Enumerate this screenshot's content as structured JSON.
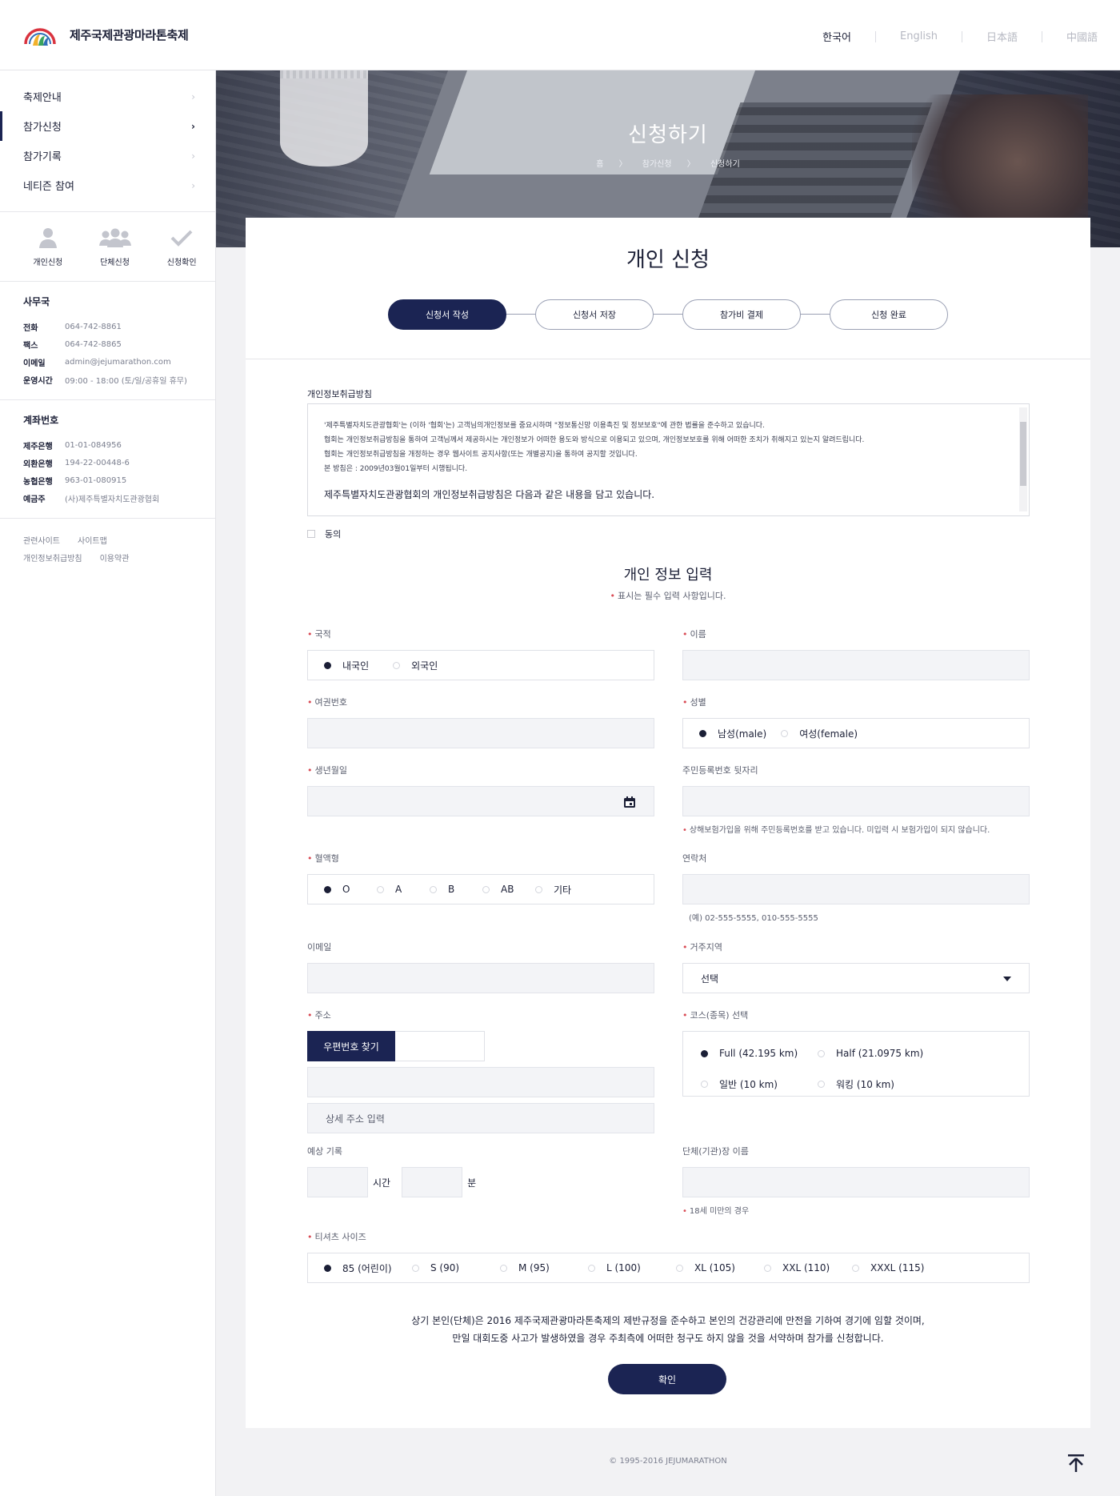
{
  "header": {
    "site_title": "제주국제관광마라톤축제",
    "languages": [
      "한국어",
      "English",
      "日本語",
      "中國語"
    ],
    "active_language": "한국어"
  },
  "sidebar": {
    "menu": [
      {
        "label": "축제안내",
        "active": false
      },
      {
        "label": "참가신청",
        "active": true
      },
      {
        "label": "참가기록",
        "active": false
      },
      {
        "label": "네티즌 참여",
        "active": false
      }
    ],
    "quick_links": [
      {
        "label": "개인신청",
        "icon": "person-icon"
      },
      {
        "label": "단체신청",
        "icon": "group-icon"
      },
      {
        "label": "신청확인",
        "icon": "check-icon"
      }
    ],
    "office": {
      "title": "사무국",
      "rows": [
        {
          "key": "전화",
          "value": "064-742-8861"
        },
        {
          "key": "팩스",
          "value": "064-742-8865"
        },
        {
          "key": "이메일",
          "value": "admin@jejumarathon.com"
        },
        {
          "key": "운영시간",
          "value": "09:00 - 18:00 (토/일/공휴일 휴무)"
        }
      ]
    },
    "account": {
      "title": "계좌번호",
      "rows": [
        {
          "key": "제주은행",
          "value": "01-01-084956"
        },
        {
          "key": "외환은행",
          "value": "194-22-00448-6"
        },
        {
          "key": "농협은행",
          "value": "963-01-080915"
        },
        {
          "key": "예금주",
          "value": "(사)제주특별자치도관광협회"
        }
      ]
    },
    "footer_links": [
      "관련사이트",
      "사이트맵",
      "개인정보취급방침",
      "이용약관"
    ]
  },
  "banner": {
    "title": "신청하기",
    "breadcrumb": [
      "홈",
      "〉",
      "참가신청",
      "〉",
      "신청하기"
    ]
  },
  "form": {
    "title": "개인 신청",
    "steps": [
      "신청서 작성",
      "신청서 저장",
      "참가비 결제",
      "신청 완료"
    ],
    "active_step": 0,
    "policy": {
      "label": "개인정보취급방침",
      "lines": [
        "'제주특별자치도관광협회'는 (이하 '협회'는) 고객님의개인정보를 중요시하며 \"정보통신망 이용촉진 및 정보보호\"에 관한 법률을 준수하고 있습니다.",
        "협회는 개인정보취급방침을 통하여 고객님께서 제공하시는 개인정보가 어떠한 용도와 방식으로 이용되고 있으며, 개인정보보호를 위해 어떠한 조치가 취해지고 있는지 알려드립니다.",
        "협회는 개인정보취급방침을 개정하는 경우 웹사이트 공지사항(또는 개별공지)을 통하여 공지할 것입니다.",
        "본 방침은 : 2009년03월01일부터 시행됩니다."
      ],
      "emphasis": "제주특별자치도관광협회의 개인정보취급방침은 다음과 같은 내용을 담고 있습니다.",
      "agree_label": "동의"
    },
    "section_title": "개인 정보 입력",
    "required_note": "표시는 필수 입력 사항입니다.",
    "fields": {
      "nationality": {
        "label": "국적",
        "options": [
          "내국인",
          "외국인"
        ],
        "selected": 0
      },
      "name": {
        "label": "이름"
      },
      "passport": {
        "label": "여권번호"
      },
      "gender": {
        "label": "성별",
        "options": [
          "남성(male)",
          "여성(female)"
        ],
        "selected": 0
      },
      "birth": {
        "label": "생년월일"
      },
      "resident_no": {
        "label": "주민등록번호 뒷자리",
        "hint": "상해보험가입을 위해 주민등록번호를 받고 있습니다. 미입력 시 보험가입이 되지 않습니다."
      },
      "blood": {
        "label": "혈액형",
        "options": [
          "O",
          "A",
          "B",
          "AB",
          "기타"
        ],
        "selected": 0
      },
      "phone": {
        "label": "연락처",
        "hint": "(예) 02-555-5555, 010-555-5555"
      },
      "email": {
        "label": "이메일"
      },
      "region": {
        "label": "거주지역",
        "value": "선택"
      },
      "address": {
        "label": "주소",
        "zip_button": "우편번호 찾기",
        "detail_placeholder": "상세 주소 입력"
      },
      "course": {
        "label": "코스(종목) 선택",
        "options": [
          "Full (42.195 km)",
          "Half (21.0975 km)",
          "일반 (10 km)",
          "워킹 (10 km)"
        ],
        "selected": 0
      },
      "expected": {
        "label": "예상 기록",
        "hour_unit": "시간",
        "min_unit": "분"
      },
      "guardian": {
        "label": "단체(기관)장 이름",
        "hint": "18세 미만의 경우"
      },
      "tshirt": {
        "label": "티셔츠 사이즈",
        "options": [
          "85 (어린이)",
          "S (90)",
          "M (95)",
          "L (100)",
          "XL (105)",
          "XXL (110)",
          "XXXL (115)"
        ],
        "selected": 0
      }
    },
    "pledge": [
      "상기 본인(단체)은 2016 제주국제관광마라톤축제의 제반규정을 준수하고 본인의 건강관리에 만전을 기하여 경기에 임할 것이며,",
      "만일 대회도중 사고가 발생하였을 경우 주최측에 어떠한 청구도 하지 않을 것을 서약하며 참가를 신청합니다."
    ],
    "confirm_label": "확인"
  },
  "footer": {
    "copyright": "© 1995-2016 JEJUMARATHON"
  },
  "colors": {
    "primary": "#1b2453",
    "required": "#d94b55",
    "input_bg": "#f3f4f7"
  }
}
